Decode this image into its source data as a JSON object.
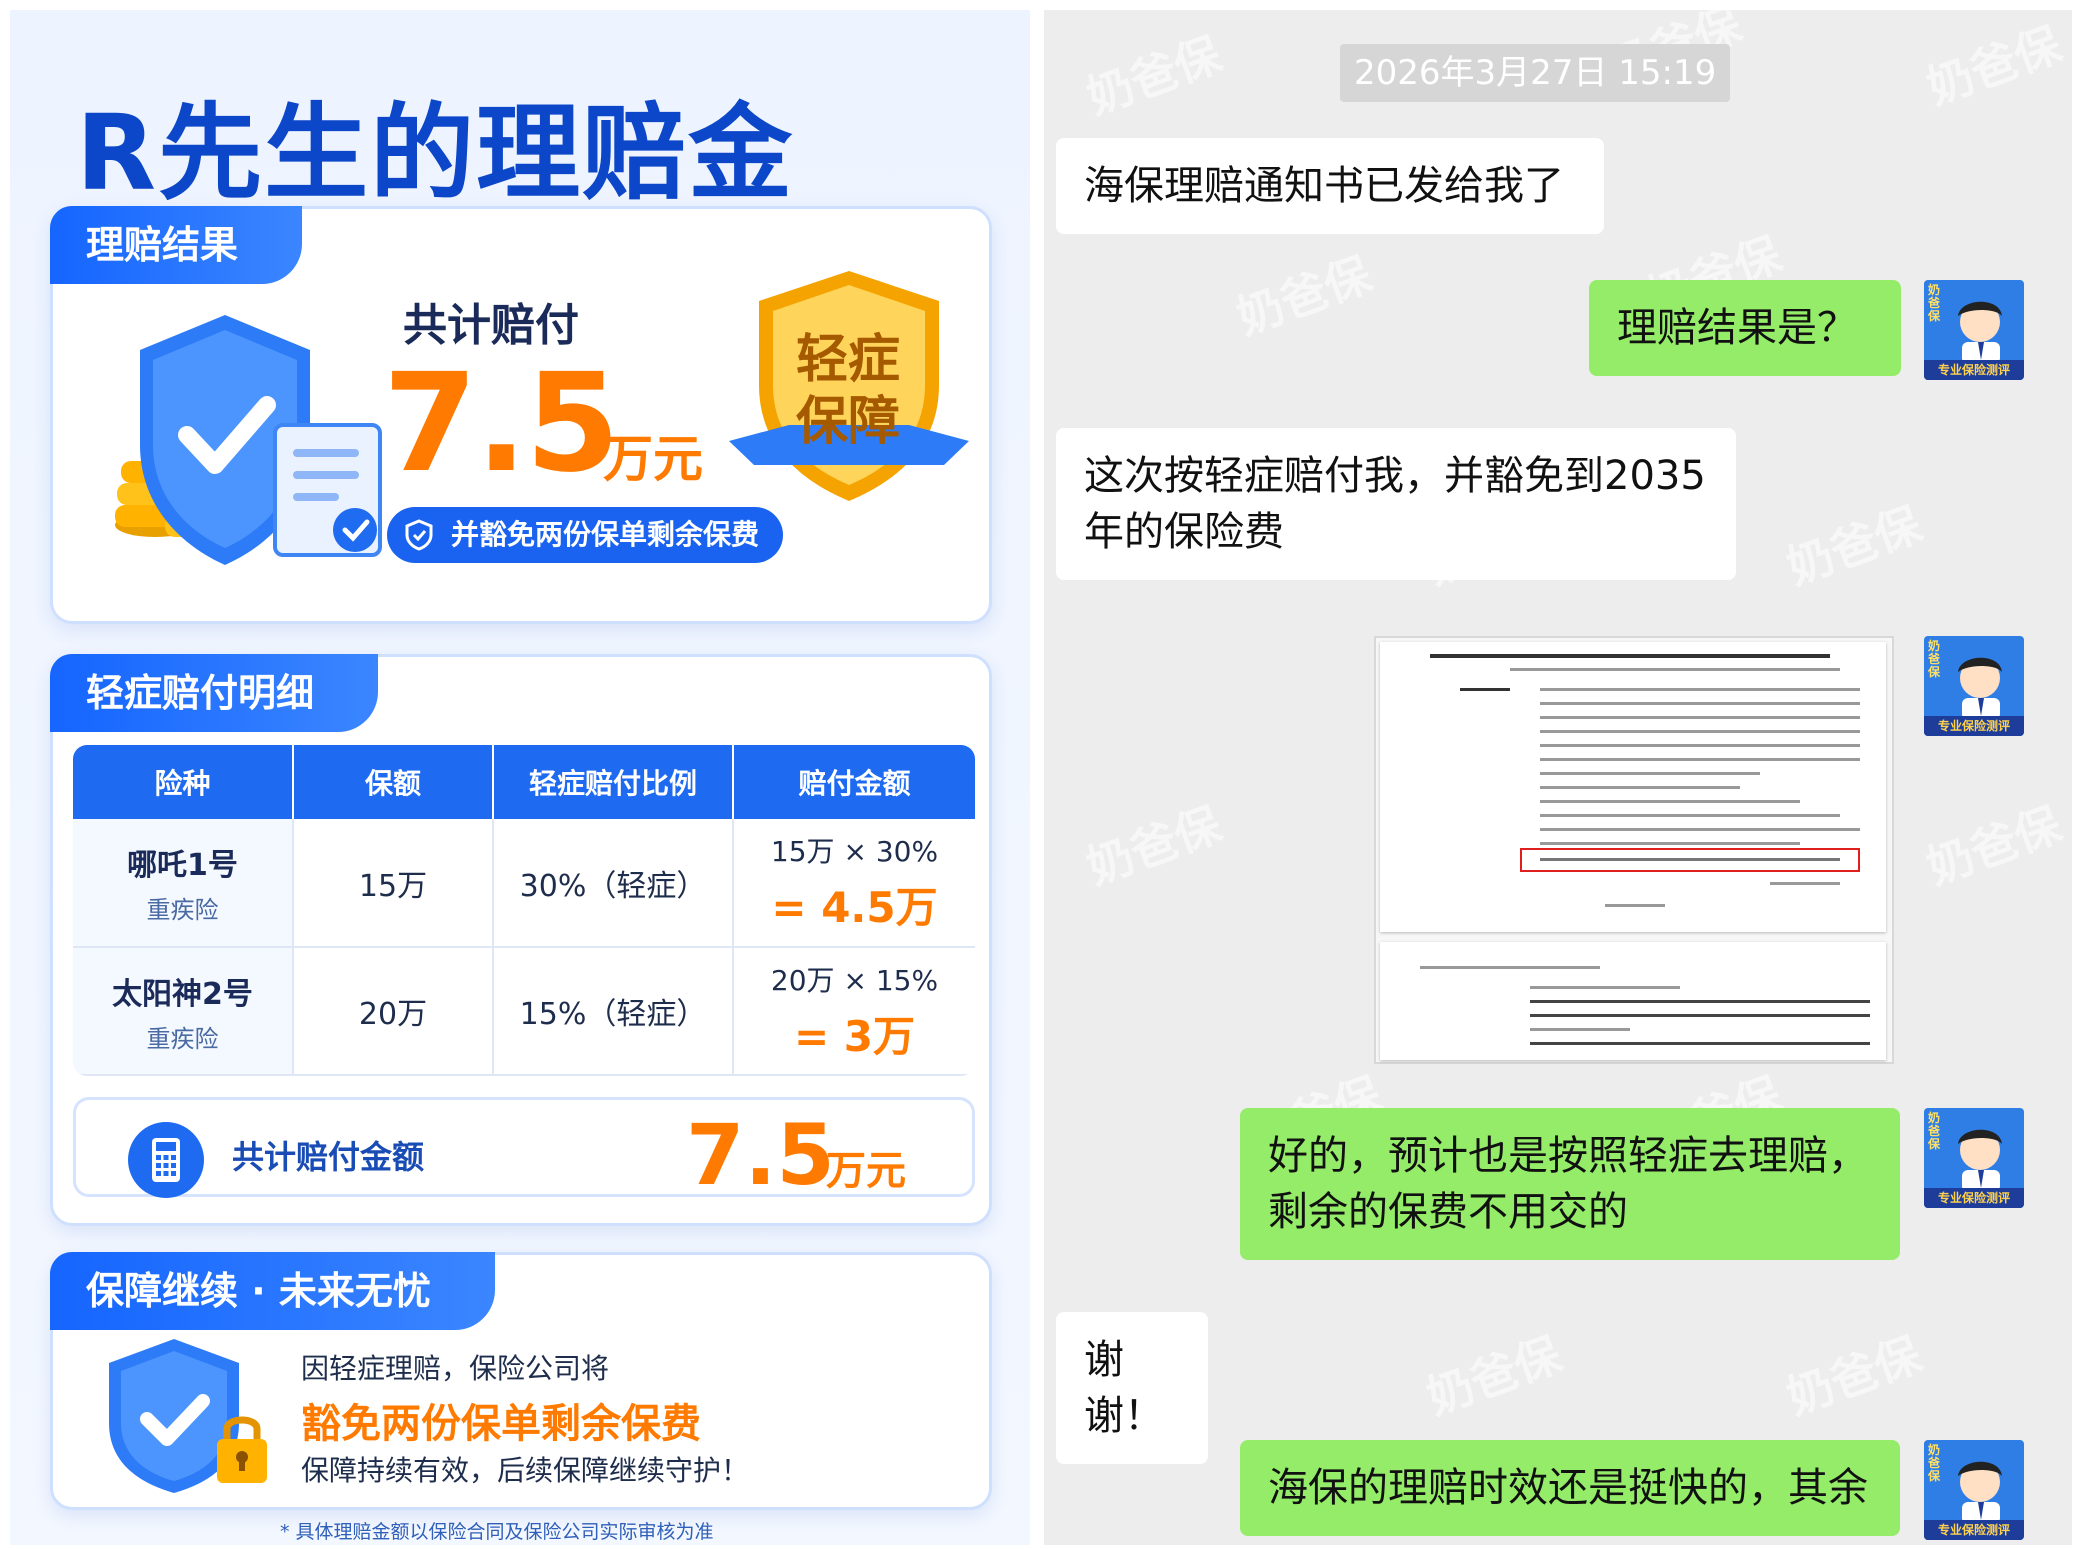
{
  "left": {
    "title": "R先生的理赔金",
    "card1": {
      "tab": "理赔结果",
      "paid_label": "共计赔付",
      "amount": "7.5",
      "unit": "万元",
      "waive": "并豁免两份保单剩余保费",
      "badge_line1": "轻症",
      "badge_line2": "保障"
    },
    "card2": {
      "tab": "轻症赔付明细",
      "headers": [
        "险种",
        "保额",
        "轻症赔付比例",
        "赔付金额"
      ],
      "rows": [
        {
          "name": "哪吒1号",
          "type": "重疾险",
          "amount": "15万",
          "ratio": "30%（轻症）",
          "calc": "15万 × 30%",
          "result": "= 4.5万"
        },
        {
          "name": "太阳神2号",
          "type": "重疾险",
          "amount": "20万",
          "ratio": "15%（轻症）",
          "calc": "20万 × 15%",
          "result": "= 3万"
        }
      ],
      "total_label": "共计赔付金额",
      "total_amount": "7.5",
      "total_unit": "万元"
    },
    "card3": {
      "tab": "保障继续 · 未来无忧",
      "line1": "因轻症理赔，保险公司将",
      "line2": "豁免两份保单剩余保费",
      "line3": "保障持续有效，后续保障继续守护！"
    },
    "footnote": "* 具体理赔金额以保险合同及保险公司实际审核为准"
  },
  "chat": {
    "timestamp": "2026年3月27日 15:19",
    "watermark": "奶爸保",
    "avatar_ribbon": "专业保险测评",
    "avatar_label": "奶爸保",
    "messages": [
      {
        "side": "in",
        "text": "海保理赔通知书已发给我了"
      },
      {
        "side": "out",
        "text": "理赔结果是？"
      },
      {
        "side": "in",
        "text_line1": "这次按轻症赔付我，并豁免到2035",
        "text_line2": "年的保险费"
      },
      {
        "side": "out",
        "text_line1": "好的，预计也是按照轻症去理赔，",
        "text_line2": "剩余的保费不用交的"
      },
      {
        "side": "in",
        "text": "谢谢！"
      },
      {
        "side": "out",
        "text": "海保的理赔时效还是挺快的，其余"
      }
    ]
  },
  "colors": {
    "brand_blue": "#1565ff",
    "accent_orange": "#ff7a00",
    "chat_out": "#95ec69",
    "chat_bg": "#ededed"
  }
}
